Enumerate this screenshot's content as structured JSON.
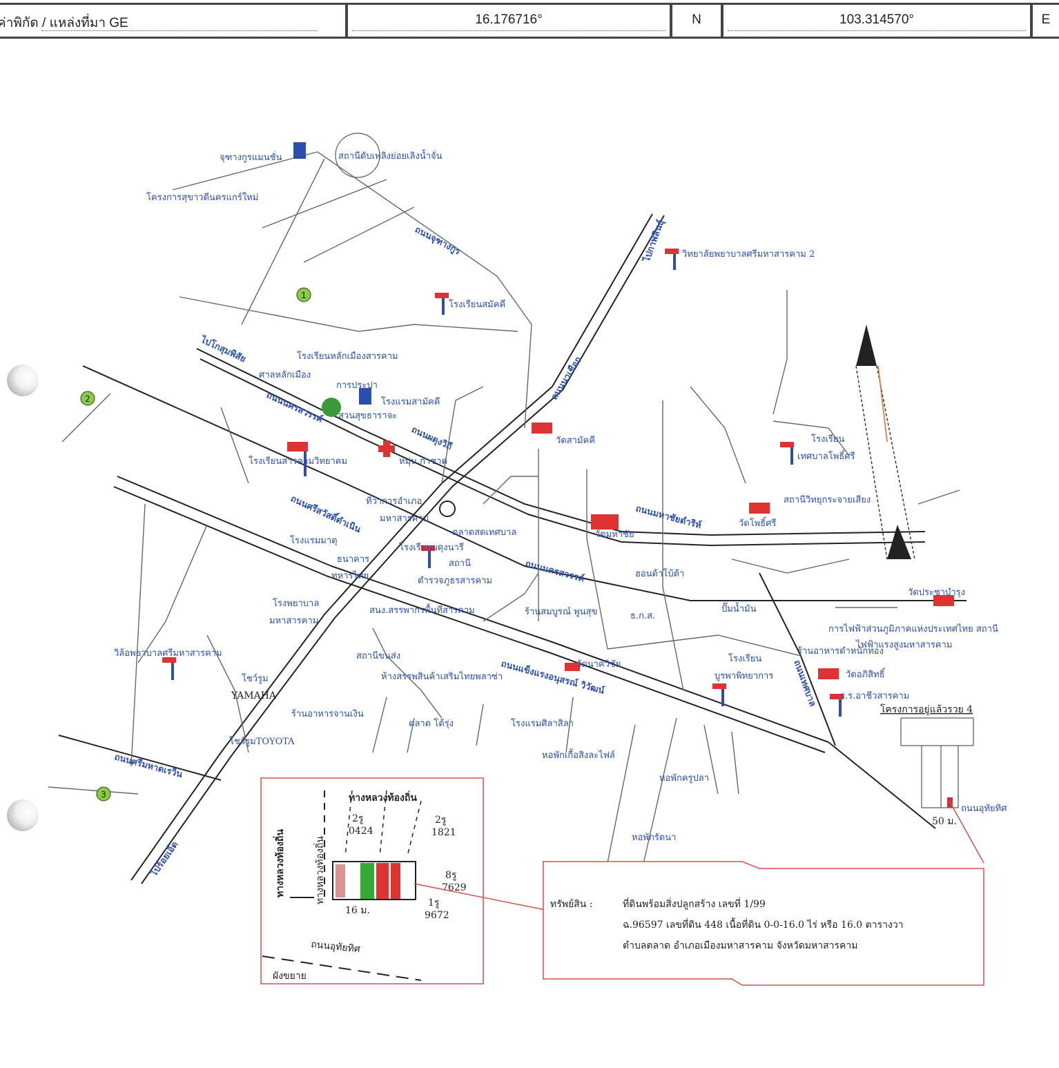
{
  "header": {
    "label": "ค่าพิกัด / แหล่งที่มา  GE",
    "latitude": "16.176716°",
    "lat_dir": "N",
    "longitude": "103.314570°",
    "lon_dir": "E"
  },
  "map": {
    "landmarks": {
      "mall": "จุฑางกูรแมนชั่น",
      "fire_station": "สถานีดับเพลิงย่อยเลิงน้ำจั่น",
      "housing_project": "โครงการสุขาวดีนครแกร์ใหม่",
      "school_1": "วิทยาลัยพยาบาลศรีมหาสารคาม 2",
      "school_2": "โรงเรียนสมัคคี",
      "school_3": "โรงเรียนหลักเมืองสารคาม",
      "city_pillar": "ศาลหลักเมือง",
      "water": "การประปา",
      "hotel_1": "โรงแรมสามัคคี",
      "park": "สวนสุขธาราจะ",
      "school_4": "โรงเรียนสารคามวิทยาคม",
      "red_cross": "หมุ่น.กาชาด",
      "temple_1": "วัดสามัคคี",
      "district_office": "ที่ว่าการอำเภอ",
      "district_office_2": "มหาสารคาม",
      "market_1": "ตลาดสดเทศบาล",
      "school_5": "โรงเรียนผดุงนารี",
      "hotel_2": "โรงแรมมาตุ",
      "bank_1": "ธนาคาร",
      "bank_1b": "ทหารไทย",
      "police": "สถานี",
      "police_2": "ตำรวจภูธรสารคาม",
      "temple_2": "วัดมหาชัย",
      "shop_1": "ฮอนด้าโบ้ต้า",
      "hospital": "โรงพยาบาล",
      "hospital_2": "มหาสารคาม",
      "office_1": "สนง.สรรพากรพื้นที่สารคาม",
      "store_1": "ร้านสมบูรณ์ พูนสุข",
      "bank_2": "ธ.ก.ส.",
      "gas_1": "ปั๊มน้ำมัน",
      "nursing": "วิล้อพยาบาลศรีมหาสารคาม",
      "toyota": "โชว์รูม",
      "yamaha": "YAMAHA",
      "toyota_2": "โชว์รูมTOYOTA",
      "station": "สถานีขนส่ง",
      "mall_2": "ห้างสรรพสินค้าเสริมไทยพลาซ่า",
      "restaurant_1": "ร้านอาหารจานเงิน",
      "market_2": "ตลาด โต้รุ่ง",
      "hotel_3": "โรงแรมศิลาสิลา",
      "dorm_1": "หอพักเกื้อสิงละไฟล์",
      "school_6": "โรงเรียน",
      "school_6b": "บูรพาพิทยาการ",
      "temple_3": "วัดนาควิชัย",
      "temple_4": "วัดโพธิ์ศรี",
      "temple_5": "วัดอภิสิทธิ์",
      "temple_6": "วัดประชาบำรุง",
      "school_7": "โรงเรียน",
      "school_7b": "เทศบาลโพธิ์ศรี",
      "radio": "สถานีวิทยุกระจายเสียง",
      "office_2": "การไฟฟ้าส่วนภูมิภาคแห่งประเทศไทย สถานี",
      "office_2b": "ไฟฟ้าแรงสูงมหาสารคาม",
      "restaurant_2": "ร้านอาหารดำหนักทอง",
      "school_8": "ร.ร.อาชีวสารคาม",
      "dorm_2": "หอพักครูปลา",
      "dorm_3": "หอพักรัตนา",
      "project_4": "โครงการอยู่แล้วรวย 4",
      "road_udom": "ถนนอุทัยทิศ",
      "dist_50": "50 ม.",
      "marker_1": "1",
      "marker_2": "2",
      "marker_3": "3"
    },
    "roads": {
      "r1": "ถนนจุฑางกูร",
      "r2": "ถนนนครสวรรค์",
      "r3": "ถนนผดุงวิถี",
      "r4": "ถนนศรีสวัสดิ์ดำเนิน",
      "r5": "ถนนนครสวรรค์",
      "r6": "ถนนแข็งแรงอนุสรณ์ วิวัฒน์",
      "r7": "ถนนนาเชือก",
      "r8": "ถนนมหาชัยดำริห์",
      "r9": "ถนนเทศบาล",
      "r10": "ไปกาฬสินธุ์",
      "r11": "ไปร้อยเอ็ด",
      "r12": "ไปโกสุมพิสัย",
      "r13": "ถนนศรีมหาดเรวิน"
    },
    "inset": {
      "road_top": "ทางหลวงท้องถิ่น",
      "road_left": "ทางหลวงท้องถิ่น",
      "road_left2": "ทางหลวงท้องถิ่น",
      "road_bottom": "ถนนอุทัยทิศ",
      "corner": "ผังขยาย",
      "p1_a": "2รู",
      "p1_b": "0424",
      "p2_a": "2รู",
      "p2_b": "1821",
      "p3_a": "8รู",
      "p3_b": "7629",
      "p4_a": "1รู",
      "p4_b": "9672",
      "dim": "16 ม."
    },
    "callout": {
      "label": "ทรัพย์สิน :",
      "line1": "ที่ดินพร้อมสิ่งปลูกสร้าง เลขที่ 1/99",
      "line2": "ฉ.96597 เลขที่ดิน 448 เนื้อที่ดิน 0-0-16.0 ไร่ หรือ 16.0 ตารางวา",
      "line3": "ตำบลตลาด อำเภอเมืองมหาสารคาม จังหวัดมหาสารคาม"
    }
  }
}
